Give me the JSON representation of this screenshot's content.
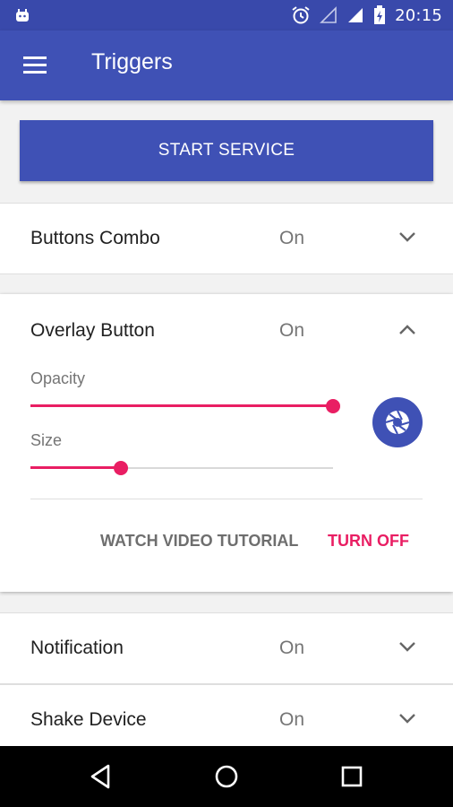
{
  "status_bar": {
    "time": "20:15"
  },
  "app_bar": {
    "title": "Triggers"
  },
  "start_button": {
    "label": "START SERVICE"
  },
  "triggers": [
    {
      "label": "Buttons Combo",
      "state": "On"
    },
    {
      "label": "Overlay Button",
      "state": "On"
    },
    {
      "label": "Notification",
      "state": "On"
    },
    {
      "label": "Shake Device",
      "state": "On"
    }
  ],
  "overlay": {
    "opacity_label": "Opacity",
    "opacity_value": 1.0,
    "size_label": "Size",
    "size_value": 0.3,
    "watch_label": "WATCH VIDEO TUTORIAL",
    "turn_off_label": "TURN OFF"
  },
  "colors": {
    "primary": "#3f51b5",
    "status": "#3949ab",
    "accent": "#e91e63"
  }
}
